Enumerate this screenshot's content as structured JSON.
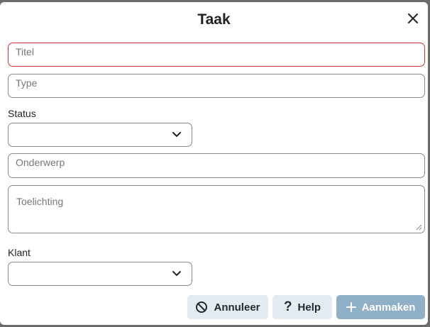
{
  "dialog": {
    "title": "Taak",
    "close_icon": "close-icon"
  },
  "form": {
    "titel_placeholder": "Titel",
    "type_placeholder": "Type",
    "status_label": "Status",
    "status_value": "",
    "onderwerp_placeholder": "Onderwerp",
    "toelichting_placeholder": "Toelichting",
    "klant_label": "Klant",
    "klant_value": ""
  },
  "buttons": {
    "cancel_label": "Annuleer",
    "help_label": "Help",
    "create_label": "Aanmaken"
  },
  "colors": {
    "error_border": "#c9353b",
    "secondary_button": "#e4ecf2",
    "primary_button_disabled": "#8fb0c7"
  }
}
